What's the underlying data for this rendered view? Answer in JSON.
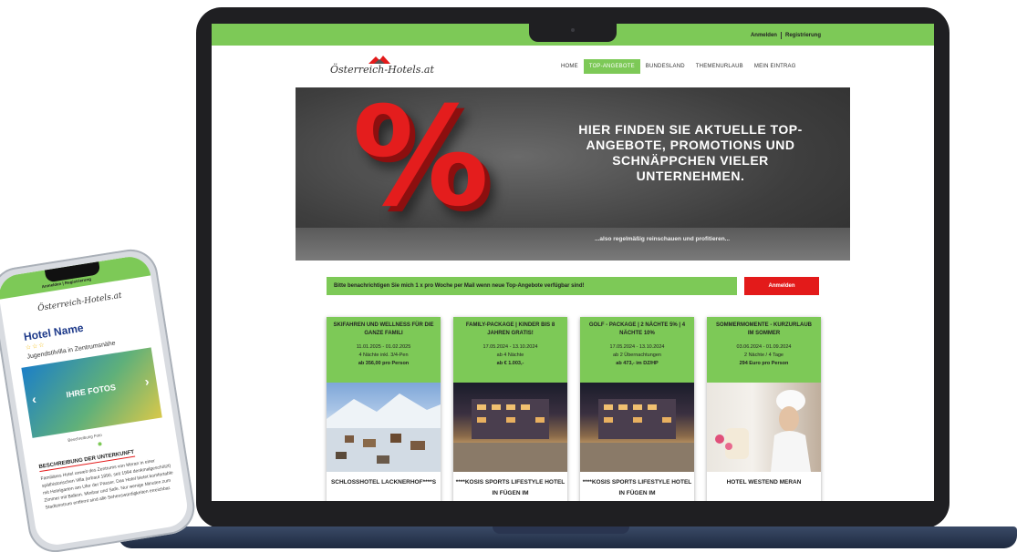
{
  "laptop": {
    "topbar": {
      "login": "Anmelden",
      "register": "Registrierung"
    },
    "logo": "Österreich-Hotels.at",
    "nav": [
      "HOME",
      "TOP-ANGEBOTE",
      "BUNDESLAND",
      "THEMENURLAUB",
      "MEIN EINTRAG"
    ],
    "nav_active_index": 1,
    "hero": {
      "symbol": "%",
      "headline": "HIER FINDEN SIE AKTUELLE TOP-ANGEBOTE, PROMOTIONS UND SCHNÄPPCHEN VIELER UNTERNEHMEN.",
      "subline": "...also regelmäßig reinschauen und profitieren..."
    },
    "notify": {
      "text": "Bitte benachrichtigen Sie mich 1 x pro Woche per Mail wenn neue Top-Angebote verfügbar sind!",
      "button": "Anmelden"
    },
    "cards": [
      {
        "title": "SKIFAHREN UND WELLNESS FÜR DIE GANZE FAMILI",
        "dates": "11.01.2025 - 01.02.2025",
        "detail": "4 Nächte inkl. 3/4-Pen",
        "price": "ab 356,00 pro Person",
        "image": "snowy-village",
        "name": "SCHLOSSHOTEL LACKNERHOF****S"
      },
      {
        "title": "FAMILY-PACKAGE | KINDER BIS 8 JAHREN GRATIS!",
        "dates": "17.05.2024 - 13.10.2024",
        "detail": "ab 4 Nächte",
        "price": "ab € 1.003,-",
        "image": "hotel-night",
        "name": "****KOSIS SPORTS LIFESTYLE HOTEL IN FÜGEN IM"
      },
      {
        "title": "GOLF - PACKAGE | 2 NÄCHTE 5% | 4 NÄCHTE 10%",
        "dates": "17.05.2024 - 13.10.2024",
        "detail": "ab 2 Übernachtungen",
        "price": "ab 473,- im DZ/HP",
        "image": "hotel-night",
        "name": "****KOSIS SPORTS LIFESTYLE HOTEL IN FÜGEN IM"
      },
      {
        "title": "SOMMERMOMENTE - KURZURLAUB IM SOMMER",
        "dates": "03.06.2024 - 01.09.2024",
        "detail": "2 Nächte / 4 Tage",
        "price": "294 Euro pro Person",
        "image": "spa-woman",
        "name": "HOTEL WESTEND MERAN"
      }
    ]
  },
  "phone": {
    "topbar": "Anmelden | Registrierung",
    "logo": "Österreich-Hotels.at",
    "hotel_name": "Hotel Name",
    "stars": "☆☆☆",
    "subline": "Jugendstilvilla in Zentrumsnähe",
    "gallery_label": "IHRE FOTOS",
    "gallery_prev": "‹",
    "gallery_next": "›",
    "caption": "Beschreibung Foto",
    "section_title": "BESCHREIBUNG DER UNTERKUNFT",
    "description": "Familiäres Hotel unweit des Zentrums von Meran in einer späthistorischen Villa (erbaut 1890, seit 1994 denkmalgeschützt) mit Hotelgarten am Ufer der Passer. Das Hotel bietet komfortable Zimmer mit Balkon. Minibar und Safe. Nur wenige Minuten zum Stadtzentrum entfernt sind alle Sehenswürdigkeiten erreichbar."
  },
  "colors": {
    "green": "#7dc957",
    "red": "#e31a1a",
    "dark": "#1f1f22"
  }
}
